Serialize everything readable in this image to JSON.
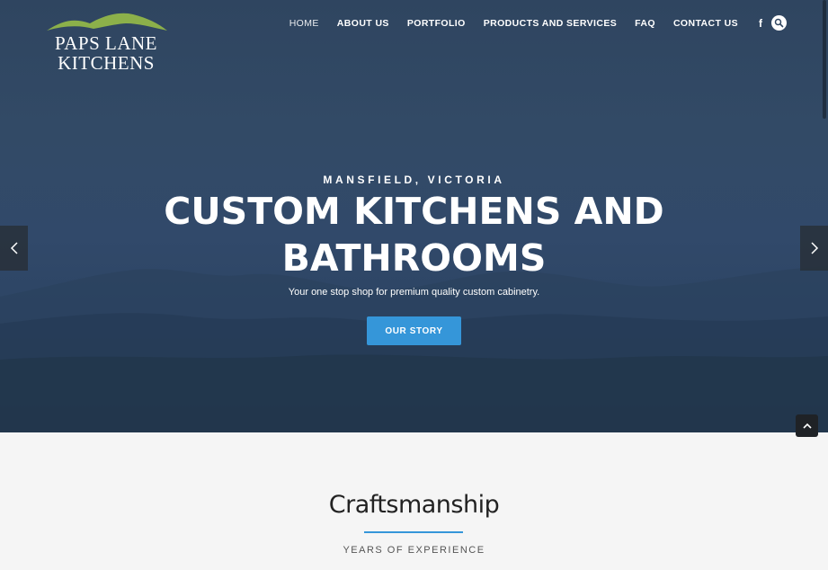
{
  "brand": {
    "line1": "PAPS LANE",
    "line2": "KITCHENS",
    "accent": "#8cb04a"
  },
  "nav": {
    "items": [
      "HOME",
      "ABOUT US",
      "PORTFOLIO",
      "PRODUCTS AND SERVICES",
      "FAQ",
      "CONTACT US"
    ],
    "active": "HOME",
    "social_icon": "facebook-icon",
    "search_icon": "search-icon"
  },
  "hero": {
    "kicker": "MANSFIELD, VICTORIA",
    "headline_line1": "CUSTOM KITCHENS AND",
    "headline_line2": "BATHROOMS",
    "subtitle": "Your one stop shop for premium quality custom cabinetry.",
    "cta_label": "OUR STORY",
    "cta_color": "#3596d9",
    "prev_icon": "chevron-left-icon",
    "next_icon": "chevron-right-icon"
  },
  "section": {
    "title": "Craftsmanship",
    "subtitle": "YEARS OF EXPERIENCE",
    "divider_color": "#3596d9"
  },
  "back_to_top_icon": "chevron-up-icon"
}
